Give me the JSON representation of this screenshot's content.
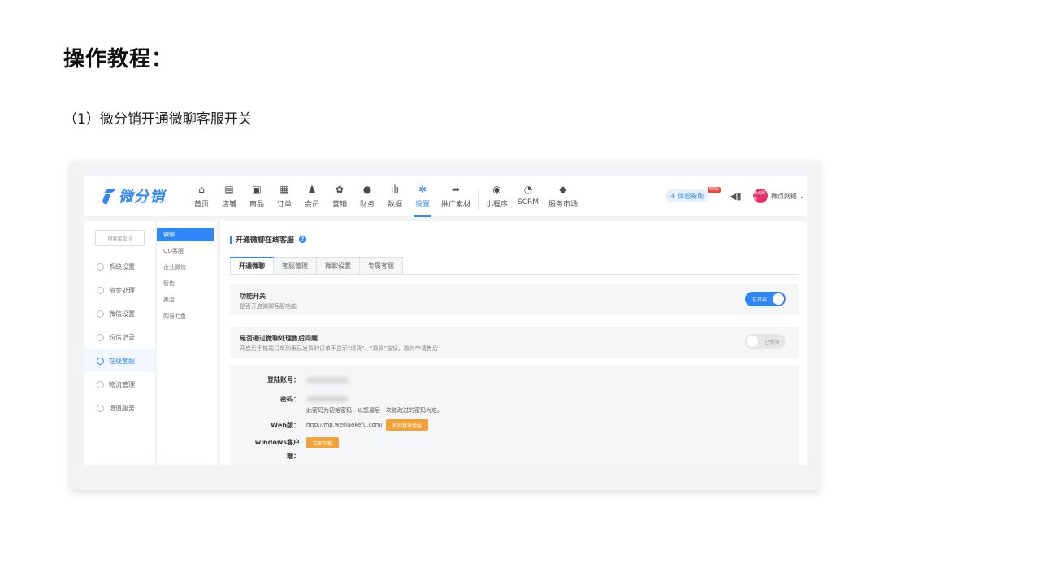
{
  "page": {
    "title": "操作教程：",
    "step": "（1）微分销开通微聊客服开关"
  },
  "app": {
    "logo_text": "微分销",
    "nav": [
      {
        "label": "首页",
        "icon": "home-icon",
        "glyph": "⌂"
      },
      {
        "label": "店铺",
        "icon": "store-icon",
        "glyph": "▤"
      },
      {
        "label": "商品",
        "icon": "goods-icon",
        "glyph": "▣"
      },
      {
        "label": "订单",
        "icon": "order-icon",
        "glyph": "▦"
      },
      {
        "label": "会员",
        "icon": "member-icon",
        "glyph": "♟"
      },
      {
        "label": "营销",
        "icon": "marketing-icon",
        "glyph": "✿"
      },
      {
        "label": "财务",
        "icon": "finance-icon",
        "glyph": "●"
      },
      {
        "label": "数据",
        "icon": "data-icon",
        "glyph": "ılı"
      },
      {
        "label": "设置",
        "icon": "settings-icon",
        "glyph": "✲"
      },
      {
        "label": "推广素材",
        "icon": "share-icon",
        "glyph": "➦"
      },
      {
        "label": "小程序",
        "icon": "miniapp-icon",
        "glyph": "◉"
      },
      {
        "label": "SCRM",
        "icon": "scrm-icon",
        "glyph": "◔"
      },
      {
        "label": "服务市场",
        "icon": "market-icon",
        "glyph": "◆"
      }
    ],
    "active_nav": "设置",
    "trial_label": "✈ 体验新版",
    "new_badge": "NEW",
    "speaker_glyph": "◀▮",
    "avatar_text": "微点网络",
    "user_name": "微点网络 ⌄",
    "search_placeholder": "搜索菜单 ⚲",
    "sidebar": [
      {
        "label": "系统设置",
        "icon": "system-settings-icon"
      },
      {
        "label": "资金处理",
        "icon": "funds-icon"
      },
      {
        "label": "微信设置",
        "icon": "wechat-settings-icon"
      },
      {
        "label": "短信记录",
        "icon": "sms-icon"
      },
      {
        "label": "在线客服",
        "icon": "online-service-icon"
      },
      {
        "label": "物流管理",
        "icon": "logistics-icon"
      },
      {
        "label": "增值服务",
        "icon": "value-added-icon"
      }
    ],
    "active_sidebar": "在线客服",
    "subnav": [
      "微聊",
      "QQ客服",
      "企业微信",
      "智齿",
      "美洽",
      "网易七鱼"
    ],
    "active_subnav": "微聊",
    "section_title": "开通微聊在线客服",
    "help_glyph": "?",
    "tabs": [
      "开通微聊",
      "客服管理",
      "微聊设置",
      "专属客服"
    ],
    "active_tab": "开通微聊",
    "switches": [
      {
        "title": "功能开关",
        "desc": "是否开启微聊客服功能",
        "state": "已开启",
        "on": true
      },
      {
        "title": "是否通过微聊处理售后问题",
        "desc": "开启后手机端订单列表已发货的订单不显示\"退货\"、\"换货\"按钮，改为申请售后",
        "state": "已关闭",
        "on": false
      }
    ],
    "account": {
      "login_label": "登陆账号：",
      "password_label": "密码：",
      "password_note": "此密码为初始密码，以您最后一次修改过的密码为准。",
      "web_label": "Web版：",
      "web_url": "http://mp.weiliaokefu.com/",
      "copy_button": "复制登录地址",
      "windows_label": "windows客户",
      "windows_label_2": "端：",
      "download_button": "立即下载"
    },
    "colors": {
      "accent": "#2f86f6",
      "orange": "#f2a23a",
      "badge": "#f5483b"
    }
  }
}
